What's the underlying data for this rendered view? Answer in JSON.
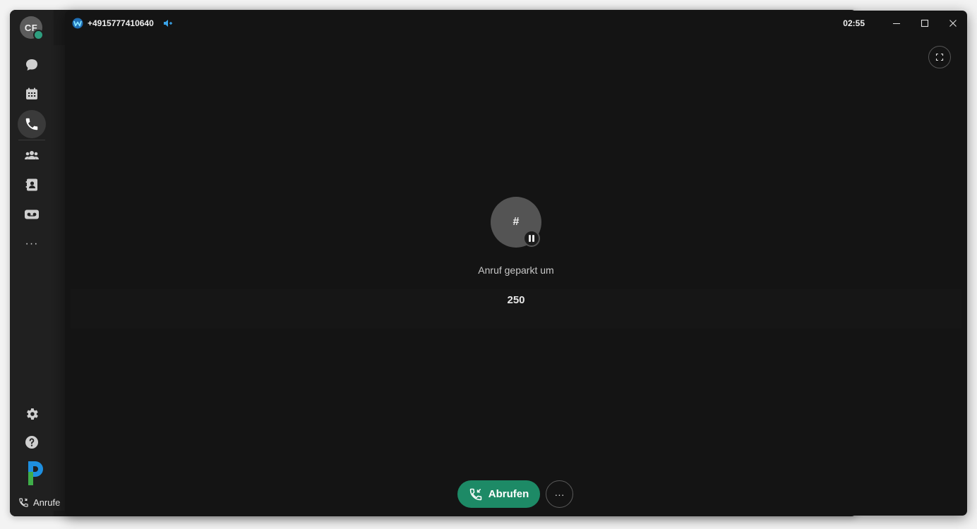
{
  "app": {
    "user_initials": "CF",
    "presence_color": "#2e9e7f",
    "sidebar_icons": [
      "chat-icon",
      "calendar-icon",
      "phone-icon",
      "team-icon",
      "contacts-icon",
      "voicemail-icon",
      "more-icon"
    ],
    "active_item": "phone-icon",
    "more_label": "···",
    "bottom_icons": [
      "settings-icon",
      "help-icon",
      "brand-logo"
    ],
    "call_status_label": "Anrufe"
  },
  "call": {
    "caller_number": "+4915777410640",
    "timer": "02:55",
    "avatar_symbol": "#",
    "status_label": "Anruf geparkt um",
    "park_number": "250",
    "retrieve_label": "Abrufen",
    "more_label": "···",
    "accent_color": "#1d8a66"
  }
}
